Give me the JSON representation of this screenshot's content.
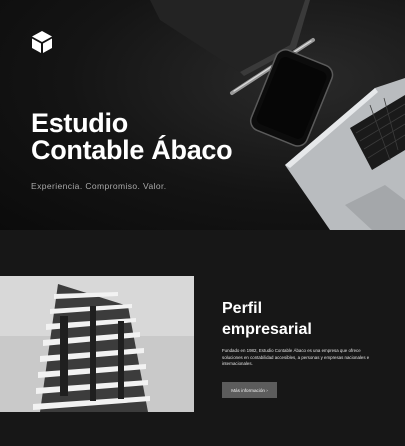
{
  "hero": {
    "title_line1": "Estudio",
    "title_line2": "Contable Ábaco",
    "subtitle": "Experiencia. Compromiso. Valor.",
    "logo_icon": "cube-icon"
  },
  "profile": {
    "title_line1": "Perfil",
    "title_line2": "empresarial",
    "description": "Fundado en 1982, Estudio Contable Ábaco es una empresa que ofrece soluciones en contabilidad accesibles, a personas y empresas nacionales e internacionales.",
    "button_label": "Más información ›"
  },
  "colors": {
    "background": "#171717",
    "hero_dark": "#0b0b0b",
    "button": "#5c5c5c",
    "text": "#ffffff"
  }
}
